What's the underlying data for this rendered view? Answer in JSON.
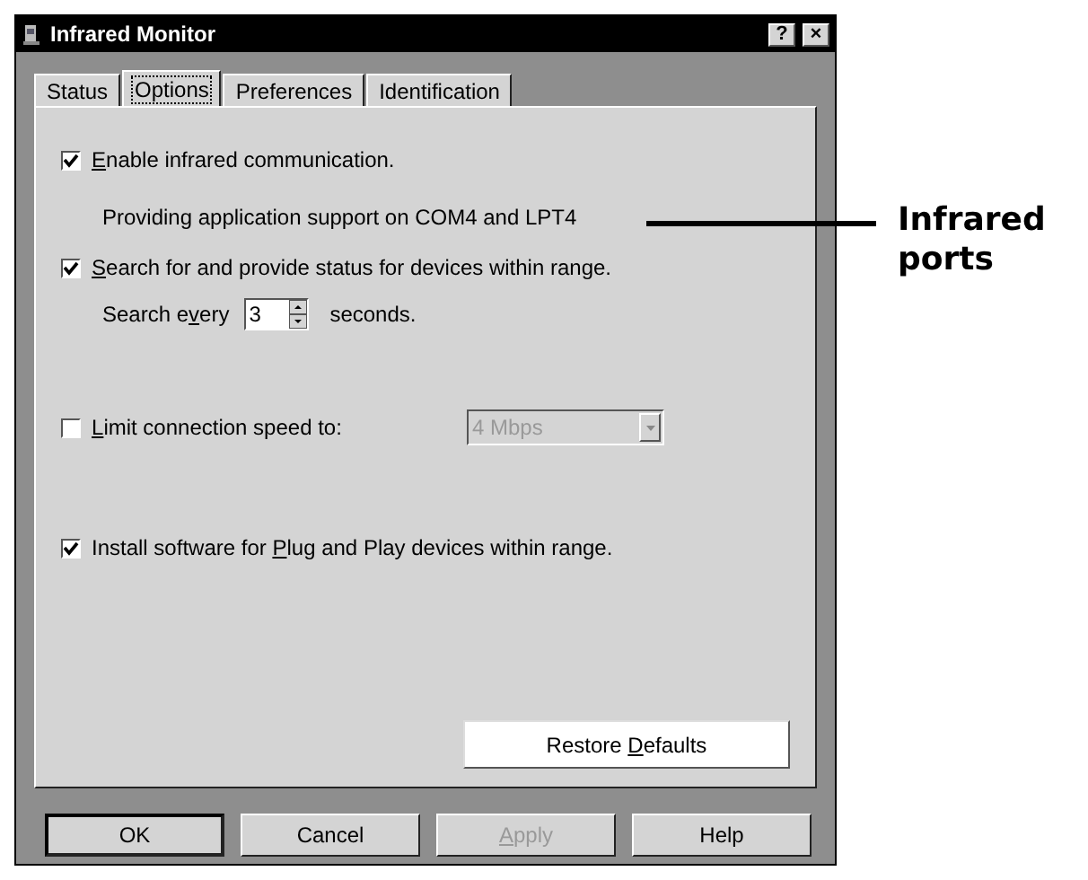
{
  "window": {
    "title": "Infrared Monitor",
    "title_buttons": [
      "?",
      "×"
    ]
  },
  "tabs": [
    {
      "label": "Status",
      "selected": false
    },
    {
      "label": "Options",
      "selected": true
    },
    {
      "label": "Preferences",
      "selected": false
    },
    {
      "label": "Identification",
      "selected": false
    }
  ],
  "options": [
    {
      "kind": "checkbox",
      "checked": true,
      "label": {
        "key": "E",
        "after": "nable infrared communication."
      }
    },
    {
      "kind": "note",
      "text": "Providing application support on COM4 and LPT4"
    },
    {
      "kind": "checkbox",
      "checked": true,
      "label": {
        "key": "S",
        "after": "earch for and provide status for devices within range."
      }
    },
    {
      "kind": "spinner",
      "label": {
        "before": "Search e",
        "key": "v",
        "after": "ery"
      },
      "value": "3",
      "unit": "seconds."
    },
    {
      "kind": "combo",
      "checked": false,
      "label": {
        "key": "L",
        "after": "imit connection speed to:"
      },
      "value": "4 Mbps",
      "disabled": true
    },
    {
      "kind": "checkbox",
      "checked": true,
      "label": {
        "before": "Install software for ",
        "key": "P",
        "after": "lug and Play devices within range."
      }
    }
  ],
  "restore_button": {
    "before": "Restore ",
    "key": "D",
    "after": "efaults"
  },
  "buttons": [
    {
      "label": {
        "before": "OK"
      },
      "disabled": false,
      "default": true
    },
    {
      "label": {
        "before": "Cancel"
      },
      "disabled": false,
      "default": false
    },
    {
      "label": {
        "key": "A",
        "after": "pply"
      },
      "disabled": true,
      "default": false
    },
    {
      "label": {
        "before": "Help"
      },
      "disabled": false,
      "default": false
    }
  ],
  "callout": {
    "text": "Infrared ports"
  }
}
